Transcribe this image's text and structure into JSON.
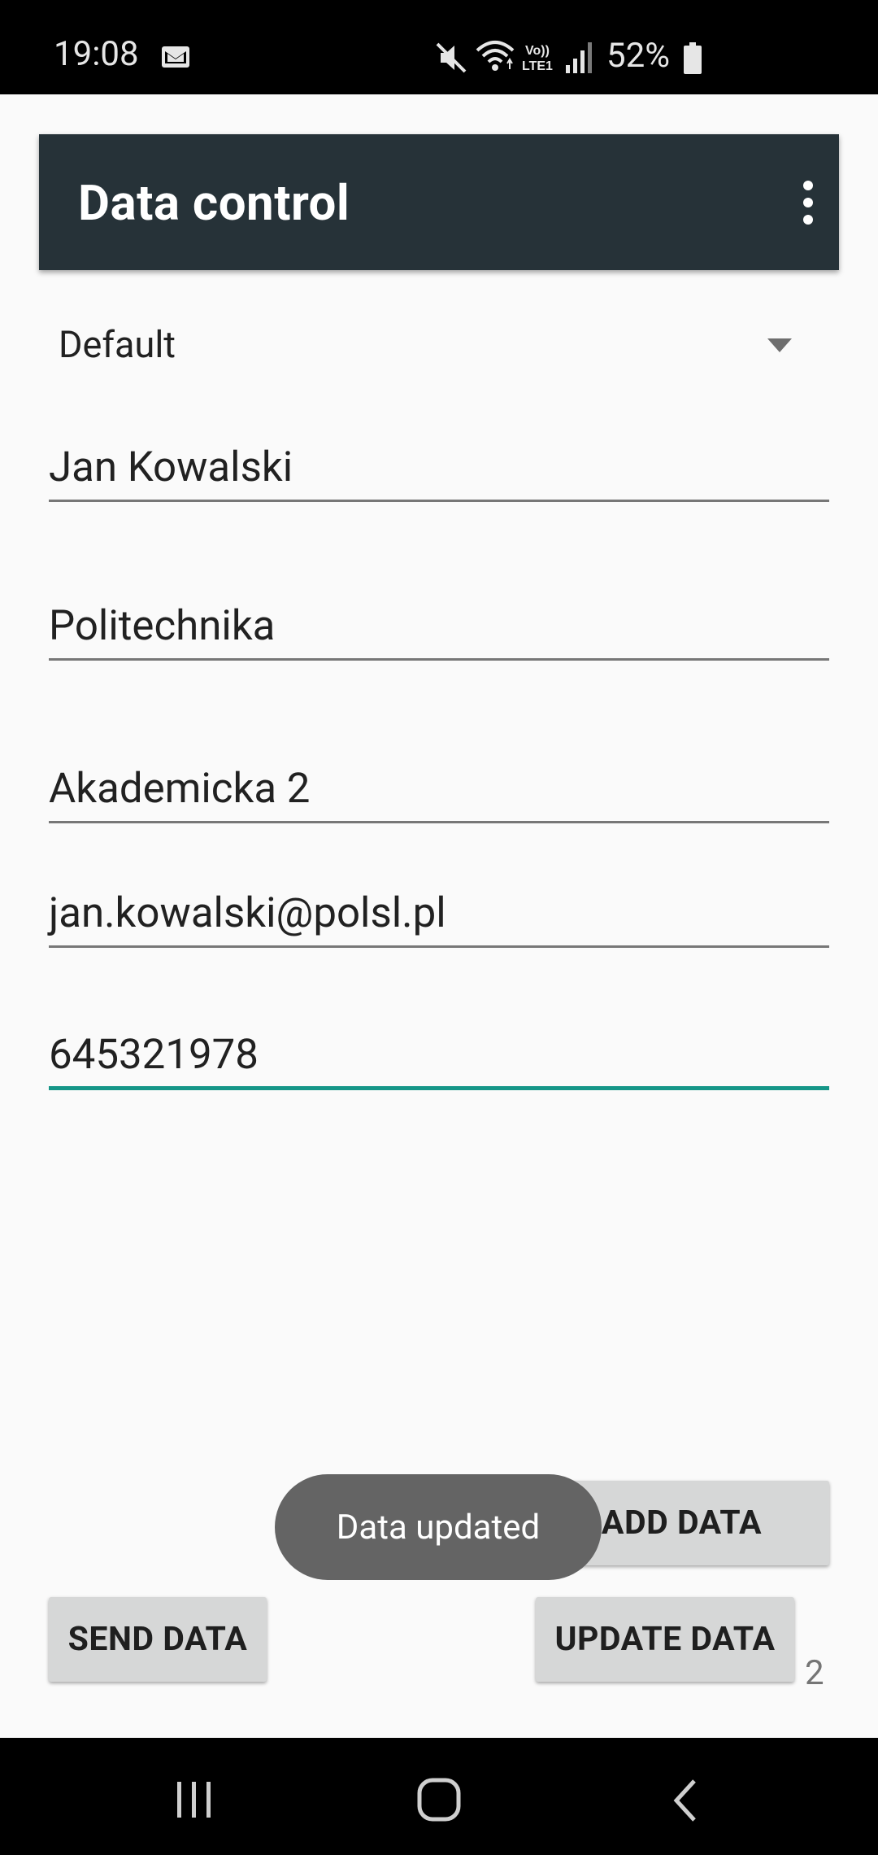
{
  "status_bar": {
    "time": "19:08",
    "battery": "52%",
    "icons": [
      "mail-icon",
      "mute-icon",
      "wifi-icon",
      "volte-icon",
      "signal-icon",
      "battery-icon"
    ]
  },
  "toolbar": {
    "title": "Data control",
    "overflow_icon": "more-vert-icon",
    "background": "#263238"
  },
  "spinner": {
    "selected": "Default"
  },
  "form": {
    "name": "Jan Kowalski",
    "institution": "Politechnika",
    "address": "Akademicka 2",
    "email": "jan.kowalski@polsl.pl",
    "phone": "645321978"
  },
  "buttons": {
    "add": "ADD DATA",
    "send": "SEND DATA",
    "update": "UPDATE DATA"
  },
  "counter": "2",
  "toast": "Data updated",
  "colors": {
    "accent": "#159688",
    "button": "#d6d7d7",
    "toast": "#646464"
  }
}
